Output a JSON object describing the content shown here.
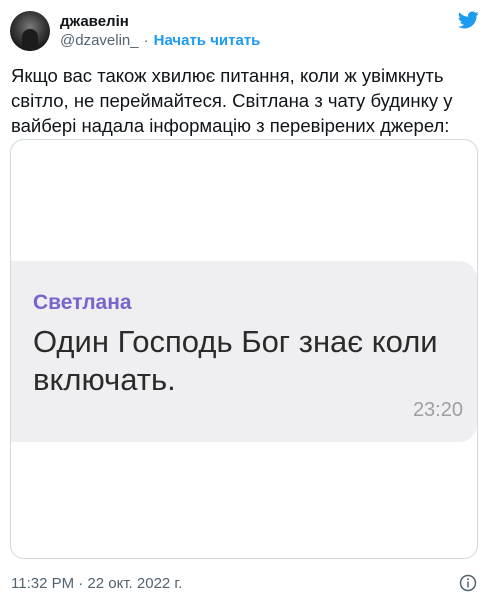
{
  "author": {
    "display_name": "джавелін",
    "handle": "@dzavelin_",
    "separator": "·",
    "follow_label": "Начать читать",
    "avatar_icon": "profile-avatar"
  },
  "brand": {
    "icon": "twitter-bird-icon",
    "color": "#1d9bf0"
  },
  "tweet": {
    "text": "Якщо вас також хвилює питання, коли ж увімкнуть світло, не переймайтеся. Світлана з чату будинку у вайбері надала інформацію з перевірених джерел:"
  },
  "media": {
    "sender": "Светлана",
    "message": "Один Господь Бог знає коли включать.",
    "time": "23:20",
    "sender_color": "#7b64c9",
    "bubble_color": "#efeff1"
  },
  "footer": {
    "timestamp": "11:32 PM · 22 окт. 2022 г.",
    "info_icon": "info-icon"
  }
}
